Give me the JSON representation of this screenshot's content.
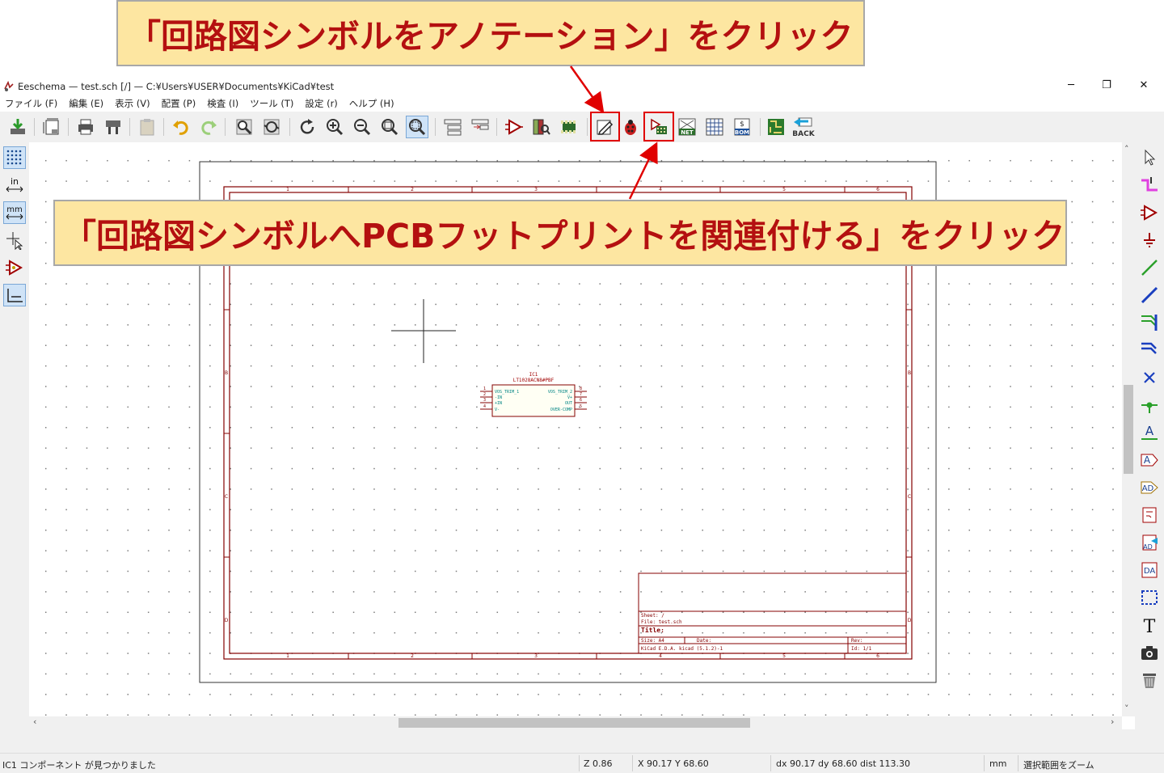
{
  "window": {
    "title": "Eeschema — test.sch [/] — C:¥Users¥USER¥Documents¥KiCad¥test",
    "minimize": "─",
    "restore": "❐",
    "close": "✕"
  },
  "menu": [
    "ファイル (F)",
    "編集 (E)",
    "表示 (V)",
    "配置 (P)",
    "検査 (I)",
    "ツール (T)",
    "設定 (r)",
    "ヘルプ (H)"
  ],
  "toolbar": {
    "net_label": "NET",
    "bom_label": "BOM",
    "back_label": "BACK"
  },
  "left_toolbar": {
    "in_label": "in",
    "mm_label": "mm"
  },
  "right_toolbar": {
    "text_label": "A",
    "label_a": "A",
    "global_label": "AD",
    "hier_label": "DA",
    "bigtext": "T"
  },
  "callouts": {
    "annotate": "「回路図シンボルをアノテーション」をクリック",
    "footprint": "「回路図シンボルへPCBフットプリントを関連付ける」をクリック"
  },
  "schematic": {
    "component": {
      "ref": "IC1",
      "value": "LT1028ACN8#PBF",
      "pins_left": [
        "VOS_TRIM_1",
        "-IN",
        "+IN",
        "V-"
      ],
      "pins_left_nums": [
        "1",
        "2",
        "3",
        "4"
      ],
      "pins_right": [
        "VOS_TRIM_2",
        "V+",
        "OUT",
        "OVER-COMP"
      ],
      "pins_right_nums": [
        "8",
        "7",
        "6",
        "5"
      ]
    },
    "border_cols": [
      "1",
      "2",
      "3",
      "4",
      "5",
      "6"
    ],
    "border_rows": [
      "A",
      "B",
      "C",
      "D"
    ],
    "titleblock": {
      "sheet": "Sheet: /",
      "file": "File: test.sch",
      "title": "Title:",
      "size": "Size: A4",
      "date": "Date:",
      "rev": "Rev:",
      "kicad": "KiCad E.D.A.  kicad (5.1.2)-1",
      "id": "Id: 1/1"
    }
  },
  "status": {
    "message": "IC1 コンポーネント が見つかりました",
    "zoom": "Z 0.86",
    "xy": "X 90.17  Y 68.60",
    "dxdy": "dx 90.17  dy 68.60  dist 113.30",
    "units": "mm",
    "tool": "選択範囲をズーム"
  },
  "colors": {
    "accent_red": "#b41010",
    "callout_bg": "#fde6a1",
    "highlight": "#e00000",
    "schematic_line": "#840000",
    "pin_text": "#008484"
  }
}
